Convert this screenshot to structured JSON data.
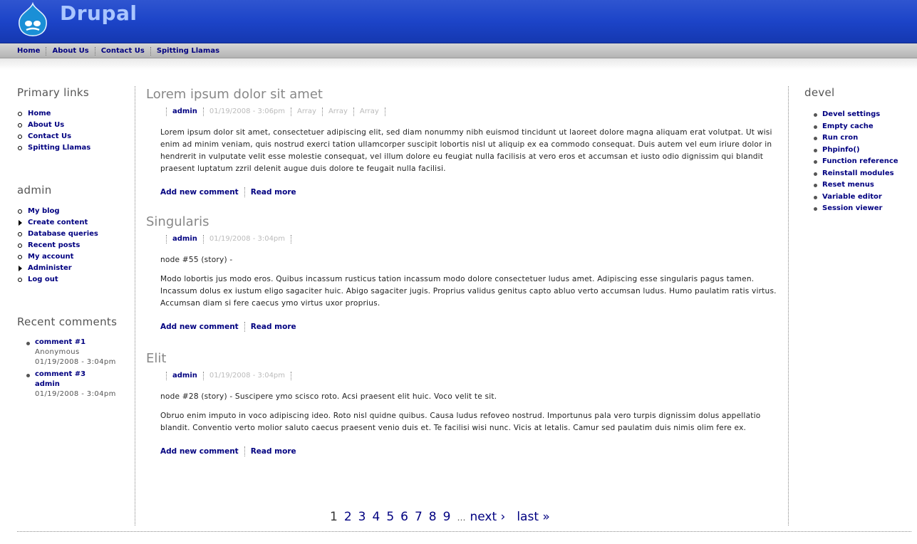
{
  "site": {
    "name": "Drupal"
  },
  "nav": {
    "links": [
      "Home",
      "About Us",
      "Contact Us",
      "Spitting Llamas"
    ]
  },
  "primary_links": {
    "title": "Primary links",
    "items": [
      "Home",
      "About Us",
      "Contact Us",
      "Spitting Llamas"
    ]
  },
  "admin_block": {
    "title": "admin",
    "items": [
      {
        "label": "My blog",
        "bullet": "circle"
      },
      {
        "label": "Create content",
        "bullet": "arrow"
      },
      {
        "label": "Database queries",
        "bullet": "circle"
      },
      {
        "label": "Recent posts",
        "bullet": "circle"
      },
      {
        "label": "My account",
        "bullet": "circle"
      },
      {
        "label": "Administer",
        "bullet": "arrow"
      },
      {
        "label": "Log out",
        "bullet": "circle"
      }
    ]
  },
  "recent_comments": {
    "title": "Recent comments",
    "items": [
      {
        "subject": "comment #1",
        "author": "Anonymous",
        "author_is_link": false,
        "date": "01/19/2008 - 3:04pm"
      },
      {
        "subject": "comment #3",
        "author": "admin",
        "author_is_link": true,
        "date": "01/19/2008 - 3:04pm"
      }
    ]
  },
  "devel": {
    "title": "devel",
    "items": [
      "Devel settings",
      "Empty cache",
      "Run cron",
      "Phpinfo()",
      "Function reference",
      "Reinstall modules",
      "Reset menus",
      "Variable editor",
      "Session viewer"
    ]
  },
  "nodes": [
    {
      "title": "Lorem ipsum dolor sit amet",
      "author": "admin",
      "date": "01/19/2008 - 3:06pm",
      "terms": [
        "Array",
        "Array",
        "Array"
      ],
      "paragraphs": [
        "Lorem ipsum dolor sit amet, consectetuer adipiscing elit, sed diam nonummy nibh euismod tincidunt ut laoreet dolore magna aliquam erat volutpat. Ut wisi enim ad minim veniam, quis nostrud exerci tation ullamcorper suscipit lobortis nisl ut aliquip ex ea commodo consequat. Duis autem vel eum iriure dolor in hendrerit in vulputate velit esse molestie consequat, vel illum dolore eu feugiat nulla facilisis at vero eros et accumsan et iusto odio dignissim qui blandit praesent luptatum zzril delenit augue duis dolore te feugait nulla facilisi."
      ],
      "links": [
        "Add new comment",
        "Read more"
      ]
    },
    {
      "title": "Singularis",
      "author": "admin",
      "date": "01/19/2008 - 3:04pm",
      "terms": [],
      "paragraphs": [
        "node #55 (story) -",
        "Modo lobortis jus modo eros. Quibus incassum rusticus tation incassum modo dolore consectetuer ludus amet. Adipiscing esse singularis pagus tamen. Incassum dolus ex iustum eligo sagaciter huic. Abigo sagaciter jugis. Proprius validus genitus capto abluo verto accumsan ludus. Humo paulatim ratis virtus. Accumsan diam si fere caecus ymo virtus uxor proprius."
      ],
      "links": [
        "Add new comment",
        "Read more"
      ]
    },
    {
      "title": "Elit",
      "author": "admin",
      "date": "01/19/2008 - 3:04pm",
      "terms": [],
      "paragraphs": [
        "node #28 (story) - Suscipere ymo scisco roto. Acsi praesent elit huic. Voco velit te sit.",
        "Obruo enim imputo in voco adipiscing ideo. Roto nisl quidne quibus. Causa ludus refoveo nostrud. Importunus pala vero turpis dignissim dolus appellatio blandit. Conventio verto molior saluto caecus praesent venio duis et. Te facilisi wisi nunc. Vicis at letalis. Camur sed paulatim duis nimis olim fere ex."
      ],
      "links": [
        "Add new comment",
        "Read more"
      ]
    }
  ],
  "pager": {
    "current": "1",
    "pages": [
      "2",
      "3",
      "4",
      "5",
      "6",
      "7",
      "8",
      "9"
    ],
    "ellipsis": "…",
    "next": "next ›",
    "last": "last »"
  }
}
